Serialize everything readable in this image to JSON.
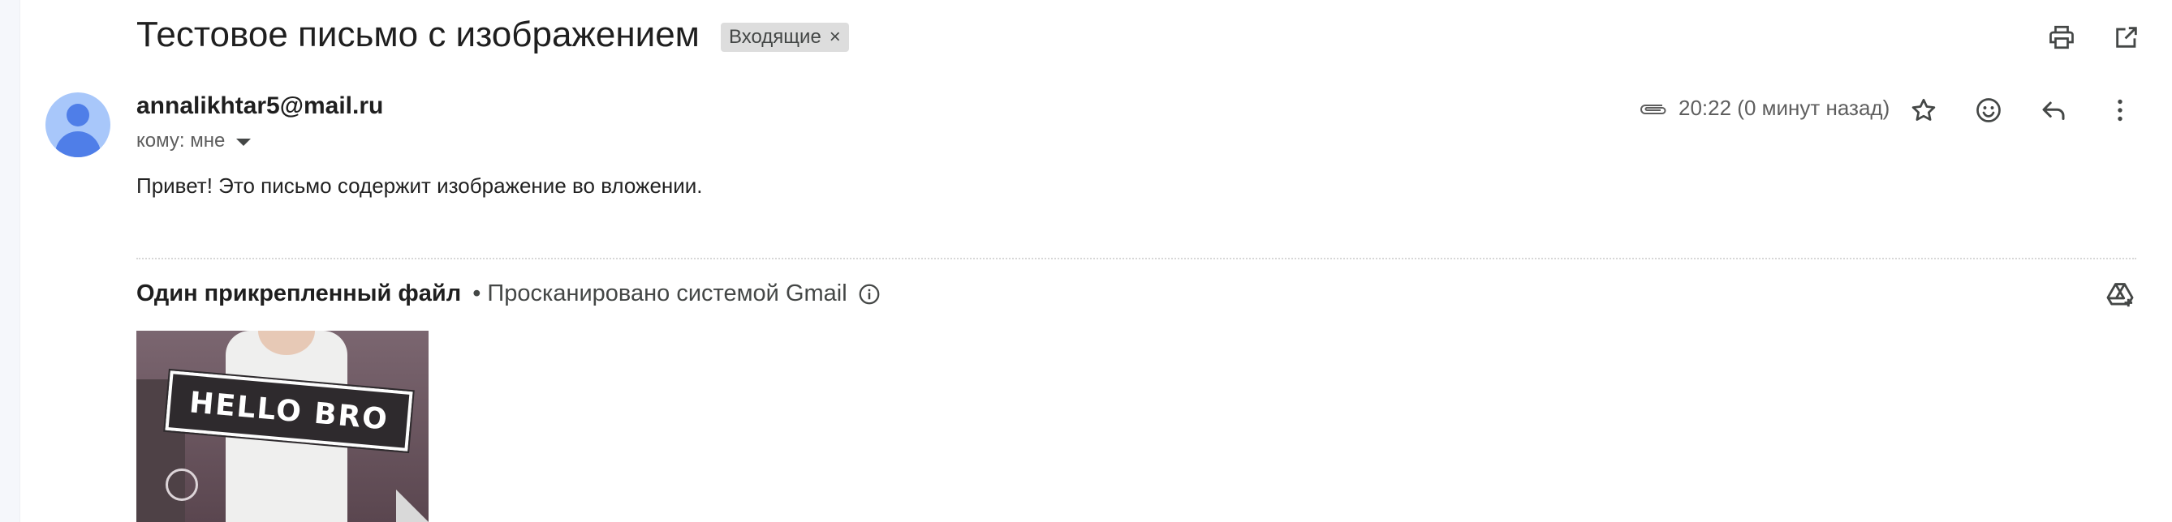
{
  "email": {
    "subject": "Тестовое письмо с изображением",
    "label_chip": "Входящие",
    "label_remove": "×",
    "sender": "annalikhtar5@mail.ru",
    "recipient": "кому: мне",
    "time": "20:22 (0 минут назад)",
    "body": "Привет! Это письмо содержит изображение во вложении."
  },
  "attachments": {
    "count_label": "Один прикрепленный файл",
    "scanned_label": "• Просканировано системой Gmail",
    "thumbnail_text": "HELLO BRO"
  },
  "icons": {
    "print": "printer-icon",
    "open_new_window": "open-in-new-icon",
    "attachment": "paperclip-icon",
    "star": "star-icon",
    "emoji": "emoji-icon",
    "reply": "reply-icon",
    "more": "more-vert-icon",
    "info": "info-icon",
    "add_to_drive": "add-to-drive-icon"
  },
  "colors": {
    "avatar_bg": "#a8c7fa",
    "avatar_fg": "#4f7ee8",
    "chip_bg": "#dddddd"
  }
}
